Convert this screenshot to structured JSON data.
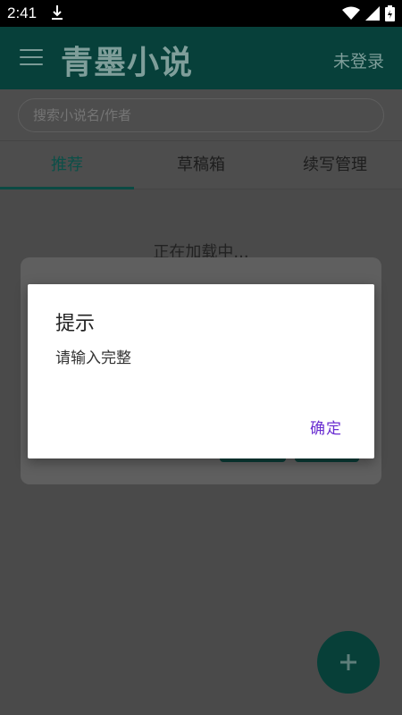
{
  "status_bar": {
    "time": "2:41"
  },
  "app_bar": {
    "title": "青墨小说",
    "login_label": "未登录"
  },
  "search": {
    "placeholder": "搜索小说名/作者"
  },
  "tabs": [
    {
      "label": "推荐"
    },
    {
      "label": "草稿箱"
    },
    {
      "label": "续写管理"
    }
  ],
  "content": {
    "loading_text": "正在加载中..."
  },
  "dialog": {
    "title": "提示",
    "message": "请输入完整",
    "ok_label": "确定"
  },
  "colors": {
    "primary": "#07403a",
    "accent": "#6a2ed1"
  }
}
